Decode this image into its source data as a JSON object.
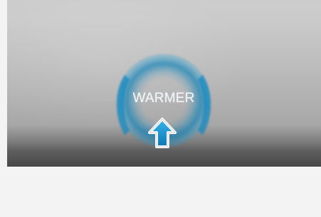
{
  "indicator": {
    "label": "WARMER",
    "icon": "up-arrow-icon",
    "accent_color": "#1a8fcb"
  }
}
